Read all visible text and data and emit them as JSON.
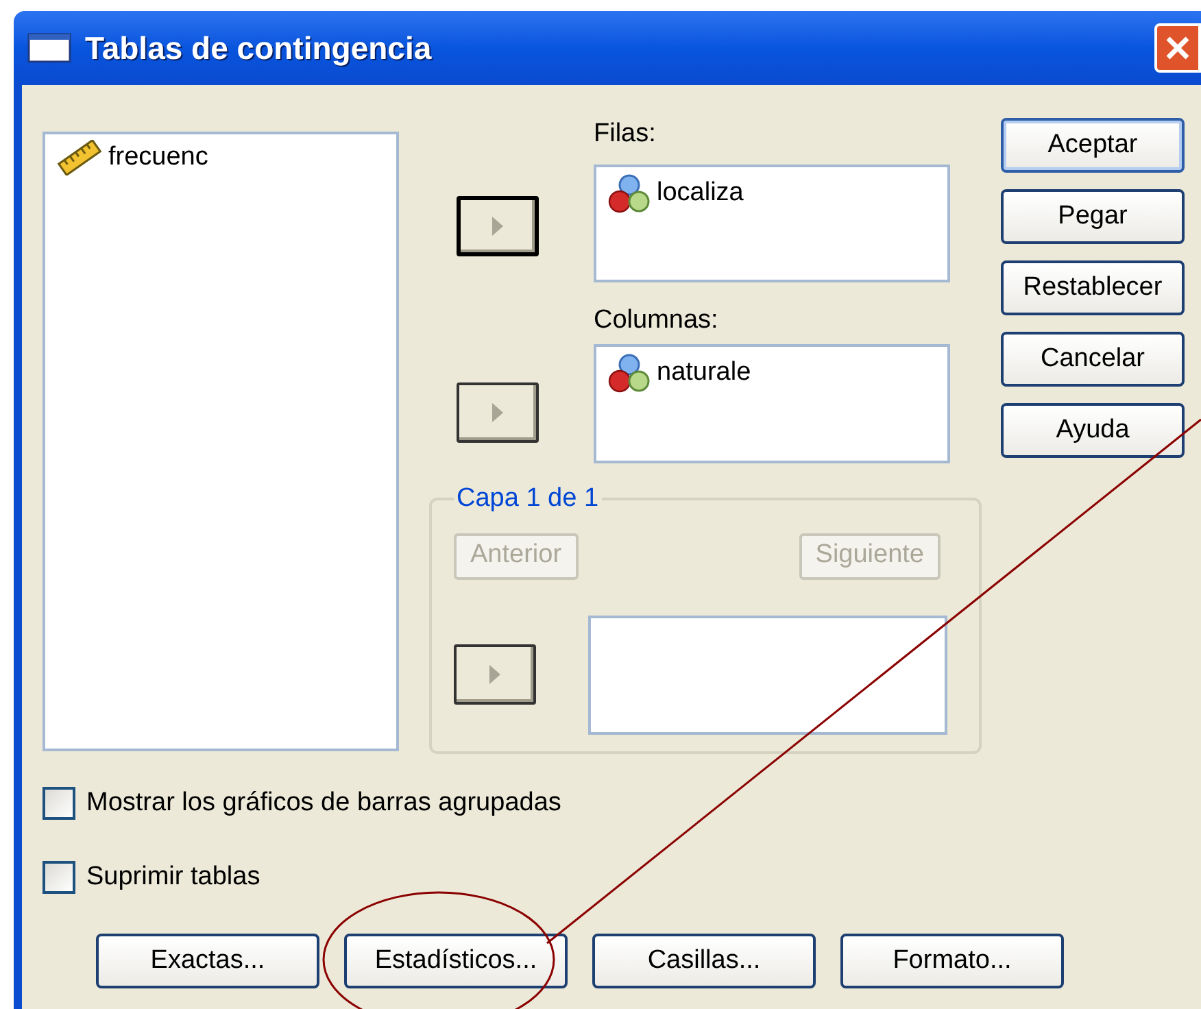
{
  "window": {
    "title": "Tablas de contingencia"
  },
  "source_list": {
    "items": [
      {
        "label": "frecuenc",
        "kind": "scale"
      }
    ]
  },
  "move_buttons": [
    {
      "default": true
    },
    {
      "default": false
    },
    {
      "default": false
    }
  ],
  "rows": {
    "label": "Filas:",
    "items": [
      {
        "label": "localiza",
        "kind": "nominal"
      }
    ]
  },
  "columns": {
    "label": "Columnas:",
    "items": [
      {
        "label": "naturale",
        "kind": "nominal"
      }
    ]
  },
  "layer": {
    "legend": "Capa 1 de 1",
    "previous": {
      "label": "Anterior",
      "disabled": true
    },
    "next": {
      "label": "Siguiente",
      "disabled": true
    }
  },
  "action_buttons": [
    {
      "label": "Aceptar",
      "default": true
    },
    {
      "label": "Pegar",
      "default": false
    },
    {
      "label": "Restablecer",
      "default": false
    },
    {
      "label": "Cancelar",
      "default": false
    },
    {
      "label": "Ayuda",
      "default": false
    }
  ],
  "checkboxes": [
    {
      "label": "Mostrar los gráficos de barras agrupadas",
      "checked": false
    },
    {
      "label": "Suprimir tablas",
      "checked": false
    }
  ],
  "option_buttons": [
    {
      "label": "Exactas..."
    },
    {
      "label": "Estadísticos..."
    },
    {
      "label": "Casillas..."
    },
    {
      "label": "Formato..."
    }
  ]
}
